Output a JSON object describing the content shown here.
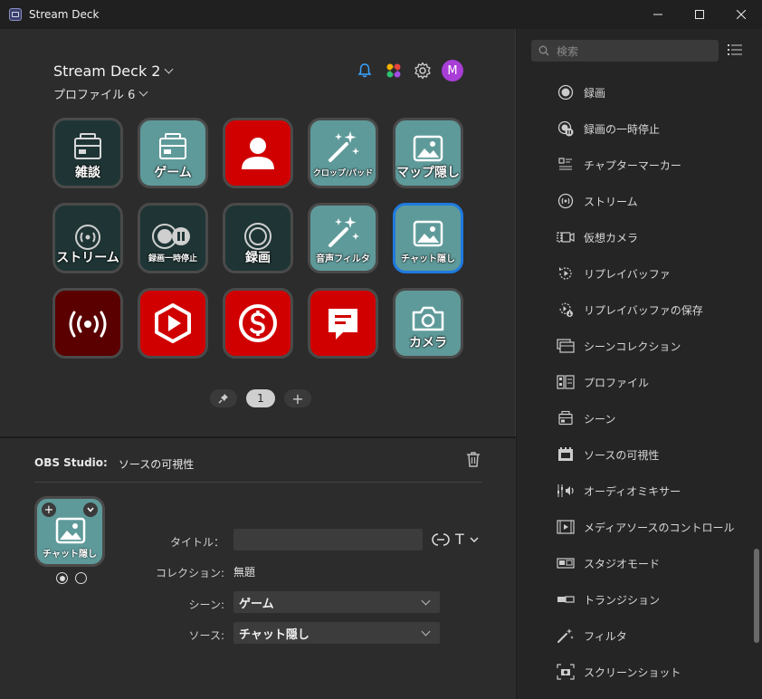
{
  "window": {
    "title": "Stream Deck"
  },
  "header": {
    "device": "Stream Deck 2",
    "profile": "プロファイル 6",
    "avatar_letter": "M"
  },
  "keys": [
    {
      "label": "雑談",
      "style": "dark",
      "icon": "scene-icon"
    },
    {
      "label": "ゲーム",
      "style": "teal",
      "icon": "scene-icon"
    },
    {
      "label": "",
      "style": "red",
      "icon": "person-icon"
    },
    {
      "label": "クロップ/パッド",
      "style": "teal",
      "icon": "magic-wand-icon"
    },
    {
      "label": "マップ隠し",
      "style": "teal",
      "icon": "image-icon"
    },
    {
      "label": "ストリーム",
      "style": "dark",
      "icon": "stream-icon"
    },
    {
      "label": "録画一時停止",
      "style": "dark",
      "icon": "record-pause-icon"
    },
    {
      "label": "録画",
      "style": "dark",
      "icon": "record-icon"
    },
    {
      "label": "音声フィルタ",
      "style": "teal",
      "icon": "magic-wand-icon"
    },
    {
      "label": "チャット隠し",
      "style": "teal",
      "icon": "image-icon",
      "selected": true
    },
    {
      "label": "",
      "style": "maroon",
      "icon": "broadcast-icon"
    },
    {
      "label": "",
      "style": "red",
      "icon": "play-hexagon-icon"
    },
    {
      "label": "",
      "style": "red",
      "icon": "dollar-icon"
    },
    {
      "label": "",
      "style": "red",
      "icon": "chat-icon"
    },
    {
      "label": "カメラ",
      "style": "teal",
      "icon": "camera-icon"
    }
  ],
  "pager": {
    "page": "1",
    "add": "+"
  },
  "inspector": {
    "source": "OBS Studio:",
    "action": "ソースの可視性",
    "preview_label": "チャット隠し",
    "title_label": "タイトル：",
    "title_value": "",
    "text_tool": "T",
    "collection_label": "コレクション:",
    "collection_value": "無題",
    "scene_label": "シーン:",
    "scene_value": "ゲーム",
    "source_label": "ソース:",
    "source_value": "チャット隠し"
  },
  "sidebar": {
    "search_placeholder": "検索",
    "actions": [
      {
        "label": "録画",
        "icon": "record-icon"
      },
      {
        "label": "録画の一時停止",
        "icon": "record-pause-icon"
      },
      {
        "label": "チャプターマーカー",
        "icon": "chapter-marker-icon"
      },
      {
        "label": "ストリーム",
        "icon": "stream-icon"
      },
      {
        "label": "仮想カメラ",
        "icon": "virtual-camera-icon"
      },
      {
        "label": "リプレイバッファ",
        "icon": "replay-buffer-icon"
      },
      {
        "label": "リプレイバッファの保存",
        "icon": "replay-save-icon"
      },
      {
        "label": "シーンコレクション",
        "icon": "scene-collection-icon"
      },
      {
        "label": "プロファイル",
        "icon": "profile-icon"
      },
      {
        "label": "シーン",
        "icon": "scene-icon"
      },
      {
        "label": "ソースの可視性",
        "icon": "source-visibility-icon"
      },
      {
        "label": "オーディオミキサー",
        "icon": "audio-mixer-icon"
      },
      {
        "label": "メディアソースのコントロール",
        "icon": "media-control-icon"
      },
      {
        "label": "スタジオモード",
        "icon": "studio-mode-icon"
      },
      {
        "label": "トランジション",
        "icon": "transition-icon"
      },
      {
        "label": "フィルタ",
        "icon": "filter-icon"
      },
      {
        "label": "スクリーンショット",
        "icon": "screenshot-icon"
      }
    ]
  }
}
